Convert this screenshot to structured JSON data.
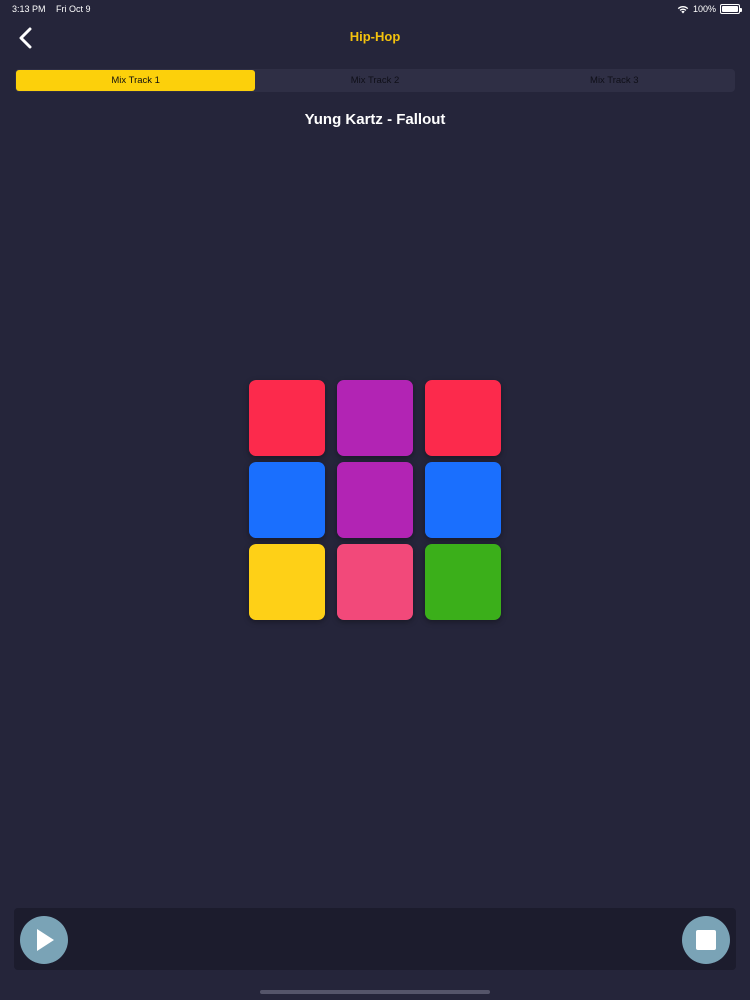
{
  "status_bar": {
    "time": "3:13 PM",
    "date": "Fri Oct 9",
    "battery": "100%",
    "icons": [
      "wifi-icon",
      "battery-icon"
    ]
  },
  "nav": {
    "title": "Hip-Hop",
    "back_icon": "chevron-left-icon"
  },
  "tabs": [
    {
      "label": "Mix Track 1",
      "active": true
    },
    {
      "label": "Mix Track 2",
      "active": false
    },
    {
      "label": "Mix Track 3",
      "active": false
    }
  ],
  "track": {
    "title": "Yung Kartz - Fallout"
  },
  "pads": [
    {
      "color": "#fc2a4c"
    },
    {
      "color": "#b224b4"
    },
    {
      "color": "#fc2a4c"
    },
    {
      "color": "#1a6ffe"
    },
    {
      "color": "#b224b4"
    },
    {
      "color": "#1a6ffe"
    },
    {
      "color": "#fed017"
    },
    {
      "color": "#f2497a"
    },
    {
      "color": "#3baf1a"
    }
  ],
  "player": {
    "play_icon": "play-icon",
    "stop_icon": "stop-icon"
  },
  "colors": {
    "background": "#25253a",
    "accent": "#fcd00b",
    "title": "#f4c20d",
    "player_button": "#7aa3b6"
  }
}
